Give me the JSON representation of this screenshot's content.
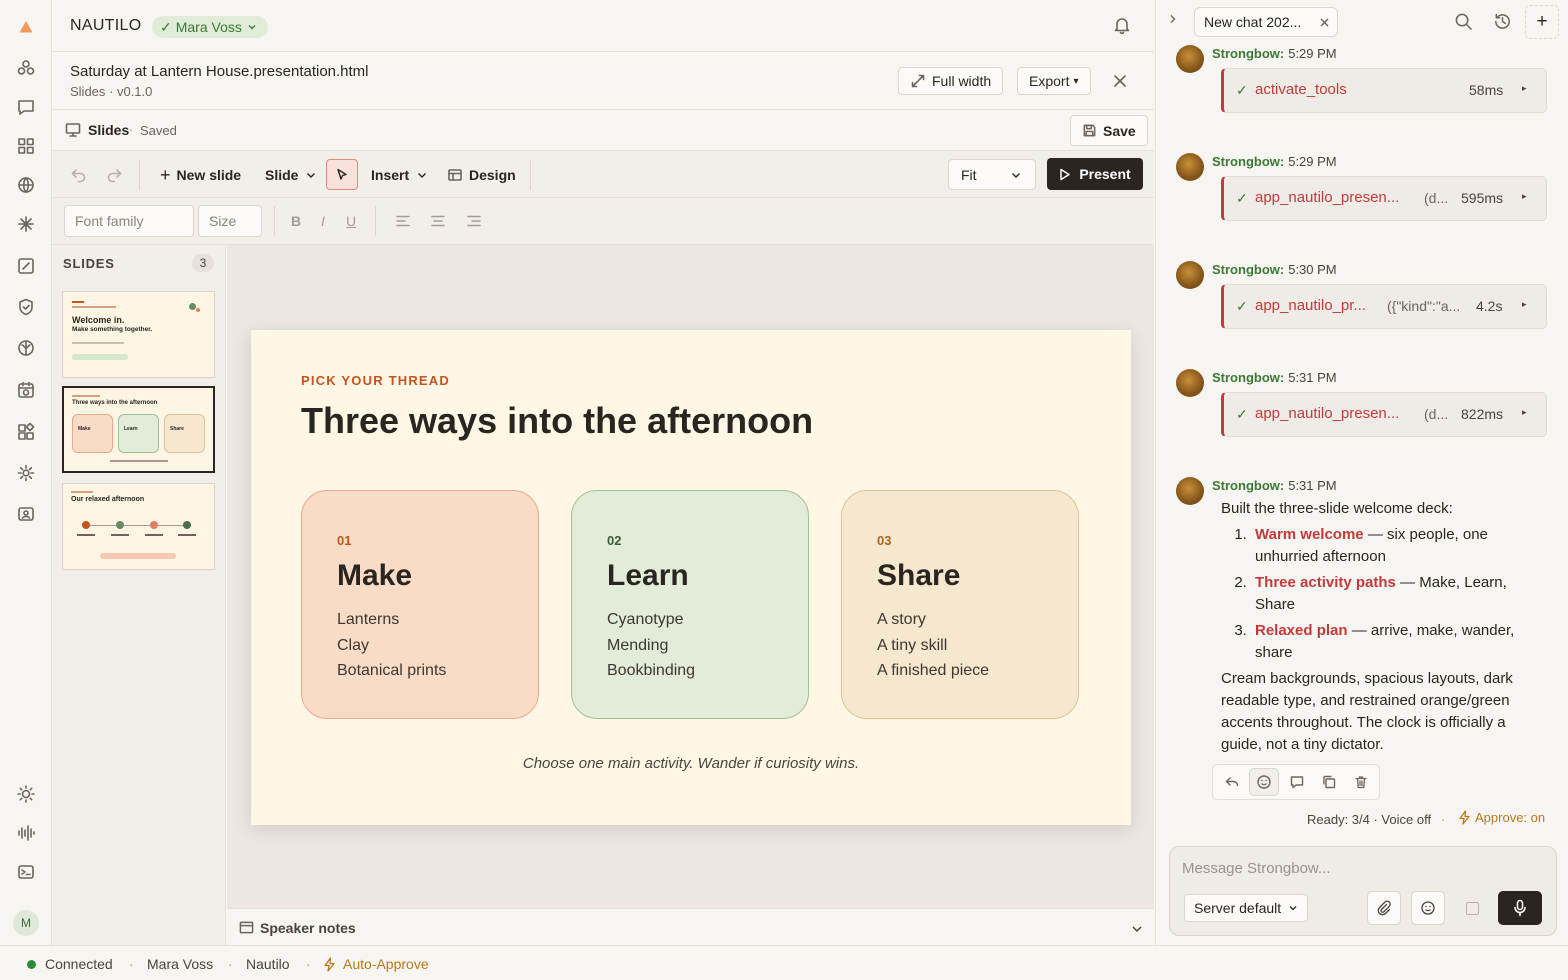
{
  "app": {
    "brand": "NAUTILO",
    "user_chip": "Mara Voss"
  },
  "document": {
    "title": "Saturday at Lantern House.presentation.html",
    "subtitle": "Slides · v0.1.0",
    "full_width_label": "Full width",
    "export_label": "Export",
    "export_caret": "▾"
  },
  "editor": {
    "label": "Slides",
    "saved": "Saved",
    "save_label": "Save"
  },
  "toolbar": {
    "new_slide": "New slide",
    "slide": "Slide",
    "insert": "Insert",
    "design": "Design",
    "fit": "Fit",
    "present": "Present"
  },
  "format": {
    "font_family_placeholder": "Font family",
    "size_placeholder": "Size",
    "bold": "B",
    "italic": "I",
    "underline": "U"
  },
  "slides_panel": {
    "label": "SLIDES",
    "count": "3",
    "thumbs": [
      {
        "title": "Welcome in.",
        "subtitle": "Make something together."
      },
      {
        "title": "Three ways into the afternoon"
      },
      {
        "title": "Our relaxed afternoon"
      }
    ]
  },
  "slide": {
    "kicker": "PICK YOUR THREAD",
    "title": "Three ways into the afternoon",
    "cards": [
      {
        "num": "01",
        "title": "Make",
        "items": [
          "Lanterns",
          "Clay",
          "Botanical prints"
        ],
        "bg": "#f8dcc6",
        "border": "#e9a890",
        "num_color": "#c4541f"
      },
      {
        "num": "02",
        "title": "Learn",
        "items": [
          "Cyanotype",
          "Mending",
          "Bookbinding"
        ],
        "bg": "#e2ecd8",
        "border": "#9fbf98",
        "num_color": "#3e5a3a"
      },
      {
        "num": "03",
        "title": "Share",
        "items": [
          "A story",
          "A tiny skill",
          "A finished piece"
        ],
        "bg": "#f5e8cf",
        "border": "#dcc496",
        "num_color": "#a8661a"
      }
    ],
    "footer": "Choose one main activity. Wander if curiosity wins."
  },
  "notes": {
    "label": "Speaker notes"
  },
  "status": {
    "connected": "Connected",
    "user": "Mara Voss",
    "app": "Nautilo",
    "auto_approve": "Auto-Approve",
    "sep": "·"
  },
  "chat": {
    "tab_label": "New chat 202...",
    "messages": [
      {
        "author": "Strongbow:",
        "time": "5:29 PM",
        "tool": "activate_tools",
        "arg": "",
        "ms": "58ms"
      },
      {
        "author": "Strongbow:",
        "time": "5:29 PM",
        "tool": "app_nautilo_presen...",
        "arg": "(d...",
        "ms": "595ms"
      },
      {
        "author": "Strongbow:",
        "time": "5:30 PM",
        "tool": "app_nautilo_pr...",
        "arg": "({\"kind\":\"a...",
        "ms": "4.2s"
      },
      {
        "author": "Strongbow:",
        "time": "5:31 PM",
        "tool": "app_nautilo_presen...",
        "arg": "(d...",
        "ms": "822ms"
      }
    ],
    "final": {
      "author": "Strongbow:",
      "time": "5:31 PM",
      "intro": "Built the three-slide welcome deck:",
      "items": [
        {
          "bold": "Warm welcome",
          "rest": " — six people, one unhurried afternoon"
        },
        {
          "bold": "Three activity paths",
          "rest": " — Make, Learn, Share"
        },
        {
          "bold": "Relaxed plan",
          "rest": " — arrive, make, wander, share"
        }
      ],
      "outro": "Cream backgrounds, spacious layouts, dark readable type, and restrained orange/green accents throughout. The clock is officially a guide, not a tiny dictator."
    },
    "ready": "Ready: 3/4 · Voice off",
    "dot": "·",
    "approve": "Approve: on",
    "composer_placeholder": "Message Strongbow...",
    "server_default": "Server default"
  }
}
